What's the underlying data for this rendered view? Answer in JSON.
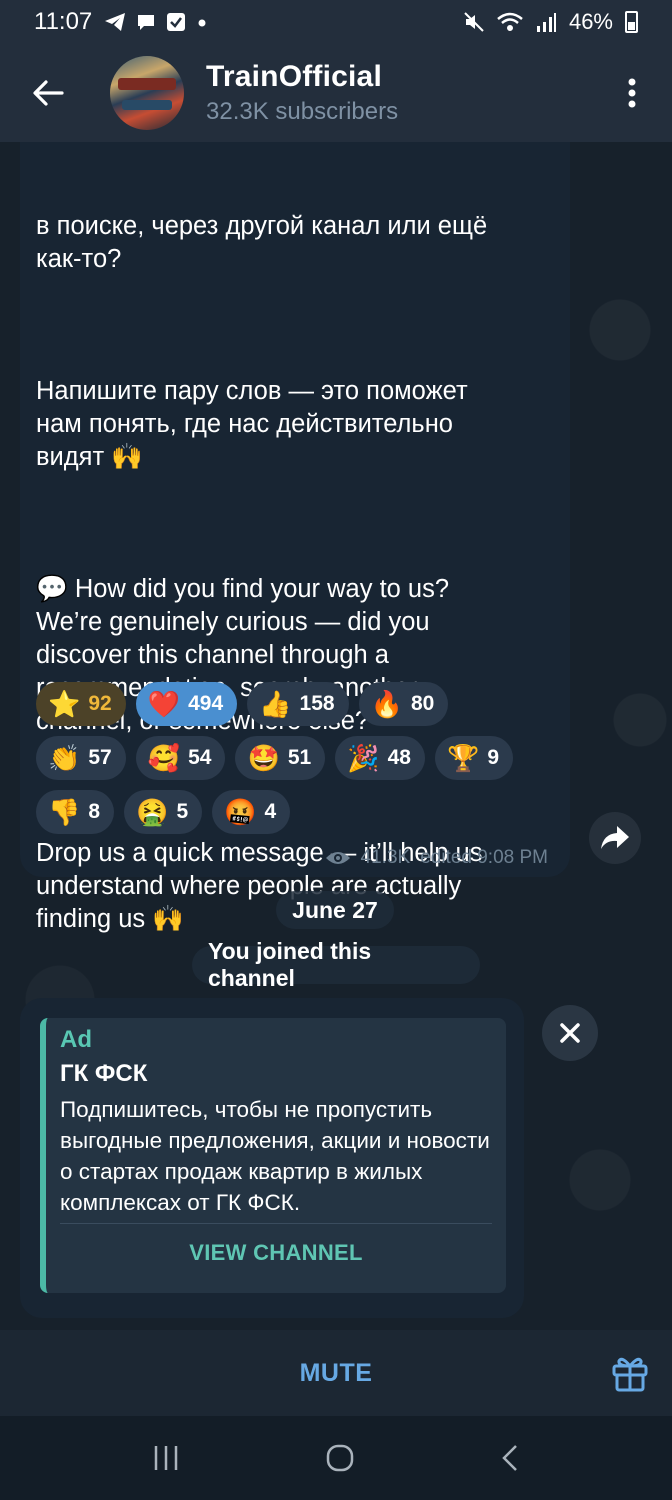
{
  "status_bar": {
    "time": "11:07",
    "battery": "46%",
    "left_icons": [
      "telegram-icon",
      "chat-icon",
      "check-icon",
      "dot-icon"
    ],
    "right_icons": [
      "mute-icon",
      "wifi-icon",
      "signal-icon",
      "battery-icon"
    ]
  },
  "header": {
    "title": "TrainOfficial",
    "subtitle": "32.3K subscribers"
  },
  "message": {
    "paragraphs": [
      "в поиске, через другой канал или ещё\nкак-то?",
      "Напишите пару слов — это поможет\nнам понять, где нас действительно\nвидят 🙌",
      "💬 How did you find your way to us?\nWe’re genuinely curious — did you\ndiscover this channel through a\nrecommendation, search, another\nchannel, or somewhere else?",
      "Drop us a quick message — it’ll help us\nunderstand where people are actually\nfinding us 🙌"
    ],
    "reactions": [
      [
        {
          "emoji": "⭐",
          "count": "92",
          "style": "gold"
        },
        {
          "emoji": "❤️",
          "count": "494",
          "style": "active"
        },
        {
          "emoji": "👍",
          "count": "158",
          "style": ""
        },
        {
          "emoji": "🔥",
          "count": "80",
          "style": ""
        }
      ],
      [
        {
          "emoji": "👏",
          "count": "57",
          "style": ""
        },
        {
          "emoji": "🥰",
          "count": "54",
          "style": ""
        },
        {
          "emoji": "🤩",
          "count": "51",
          "style": ""
        },
        {
          "emoji": "🎉",
          "count": "48",
          "style": ""
        },
        {
          "emoji": "🏆",
          "count": "9",
          "style": ""
        }
      ],
      [
        {
          "emoji": "👎",
          "count": "8",
          "style": ""
        },
        {
          "emoji": "🤮",
          "count": "5",
          "style": ""
        },
        {
          "emoji": "🤬",
          "count": "4",
          "style": ""
        }
      ]
    ],
    "views": "41.3K",
    "edited": "edited 9:08 PM"
  },
  "date_pill": "June 27",
  "joined_pill": "You joined this channel",
  "ad": {
    "label": "Ad",
    "title": "ГК ФСК",
    "text": "Подпишитесь, чтобы не пропустить выгодные предложения, акции и новости о стартах продаж квартир в жилых комплексах от ГК ФСК.",
    "button": "VIEW CHANNEL"
  },
  "bottom": {
    "mute": "MUTE"
  },
  "colors": {
    "accent": "#67a9e4",
    "ad_accent": "#4cb9a6",
    "bubble": "#182533",
    "header": "#232e3c"
  }
}
